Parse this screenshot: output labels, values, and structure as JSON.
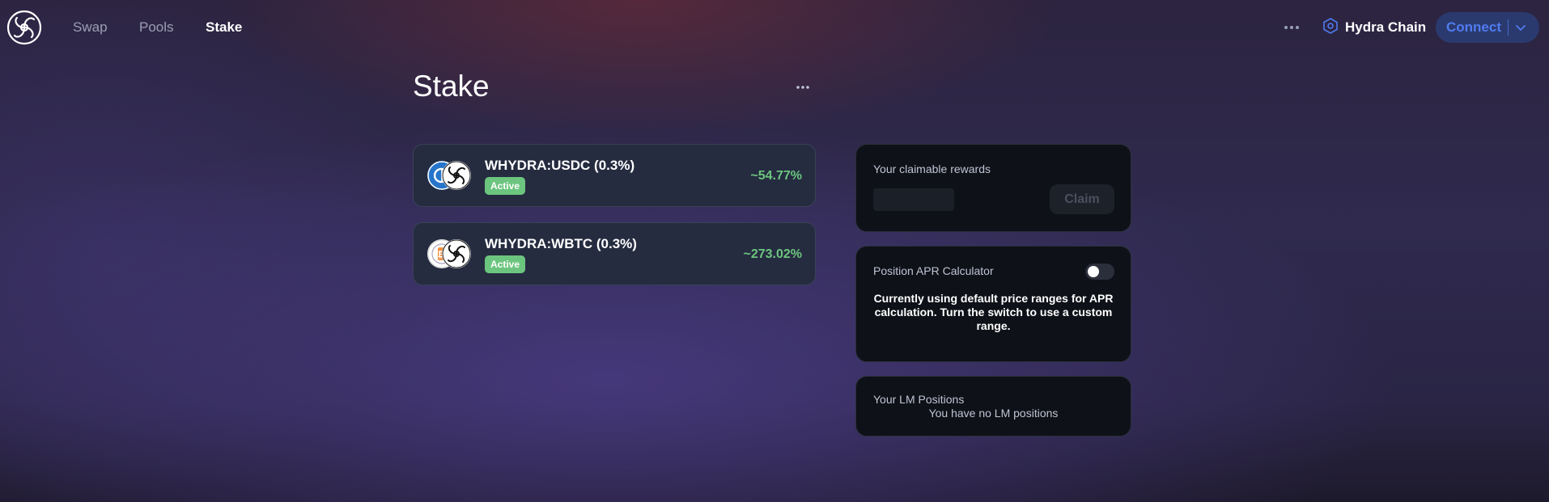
{
  "nav": {
    "links": [
      {
        "label": "Swap",
        "active": false
      },
      {
        "label": "Pools",
        "active": false
      },
      {
        "label": "Stake",
        "active": true
      }
    ],
    "chain_label": "Hydra Chain",
    "connect_label": "Connect",
    "accent_color": "#4f7cf0"
  },
  "page": {
    "title": "Stake"
  },
  "pools": [
    {
      "name": "WHYDRA:USDC (0.3%)",
      "status": "Active",
      "apr": "~54.77%",
      "token_icon": "usdc-icon"
    },
    {
      "name": "WHYDRA:WBTC (0.3%)",
      "status": "Active",
      "apr": "~273.02%",
      "token_icon": "wbtc-icon"
    }
  ],
  "rewards": {
    "label": "Your claimable rewards",
    "claim_label": "Claim"
  },
  "apr_calculator": {
    "label": "Position APR Calculator",
    "toggle_on": false,
    "description": "Currently using default price ranges for APR calculation. Turn the switch to use a custom range."
  },
  "lm_positions": {
    "label": "Your LM Positions",
    "empty_text": "You have no LM positions"
  },
  "colors": {
    "active_badge": "#6cc57e",
    "card_bg": "#252c40",
    "panel_bg": "#0e1118"
  }
}
